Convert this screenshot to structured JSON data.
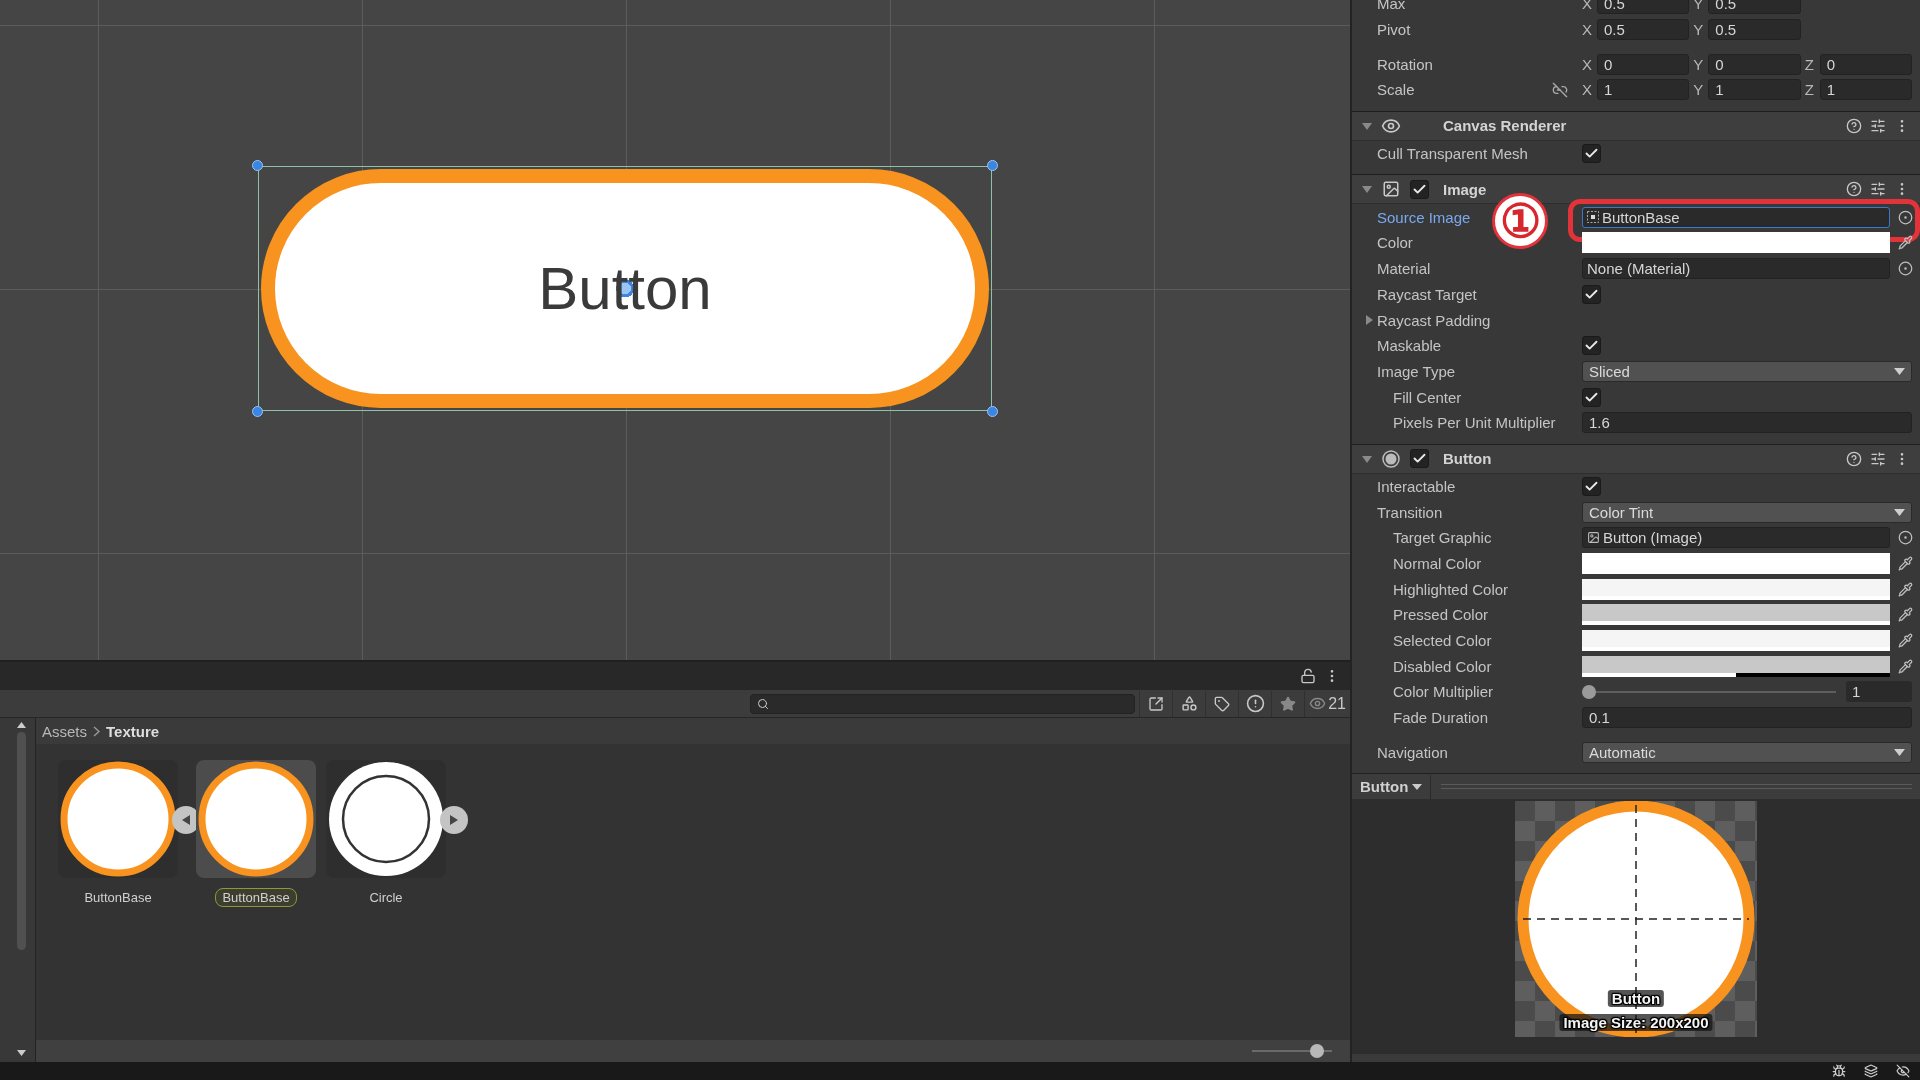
{
  "scene": {
    "button_text": "Button"
  },
  "project": {
    "item_count": "21",
    "breadcrumb": [
      {
        "label": "Assets"
      },
      {
        "label": "Texture"
      }
    ],
    "assets": [
      {
        "name": "ButtonBase",
        "kind": "bordered",
        "selected": false,
        "renaming": false,
        "expanded": true
      },
      {
        "name": "ButtonBase",
        "kind": "bordered",
        "selected": true,
        "renaming": true
      },
      {
        "name": "Circle",
        "kind": "ring",
        "selected": false,
        "renaming": false,
        "expanded": false
      }
    ],
    "zoom_slider": {
      "level": 0.88
    }
  },
  "inspector": {
    "transform": [
      {
        "label": "Max",
        "axes": [
          {
            "axis": "X",
            "value": "0.5"
          },
          {
            "axis": "Y",
            "value": "0.5"
          }
        ]
      },
      {
        "label": "Pivot",
        "axes": [
          {
            "axis": "X",
            "value": "0.5"
          },
          {
            "axis": "Y",
            "value": "0.5"
          }
        ]
      },
      {
        "label": "Rotation",
        "axes": [
          {
            "axis": "X",
            "value": "0"
          },
          {
            "axis": "Y",
            "value": "0"
          },
          {
            "axis": "Z",
            "value": "0"
          }
        ]
      },
      {
        "label": "Scale",
        "proportional": false,
        "axes": [
          {
            "axis": "X",
            "value": "1"
          },
          {
            "axis": "Y",
            "value": "1"
          },
          {
            "axis": "Z",
            "value": "1"
          }
        ]
      }
    ],
    "components": [
      {
        "title": "Canvas Renderer",
        "kind": "renderer",
        "expanded": true,
        "fields": [
          {
            "label": "Cull Transparent Mesh",
            "kind": "checkbox",
            "checked": true
          }
        ]
      },
      {
        "title": "Image",
        "kind": "image",
        "enabled": true,
        "expanded": true,
        "fields": [
          {
            "label": "Source Image",
            "kind": "spriteref",
            "value": "ButtonBase",
            "focused": true,
            "highlighted": true
          },
          {
            "label": "Color",
            "kind": "color",
            "color": "#ffffff",
            "level": 1
          },
          {
            "label": "Material",
            "kind": "object",
            "value": "None (Material)"
          },
          {
            "label": "Raycast Target",
            "kind": "checkbox",
            "checked": true
          },
          {
            "label": "Raycast Padding",
            "kind": "foldout",
            "expanded": false
          },
          {
            "label": "Maskable",
            "kind": "checkbox",
            "checked": true
          },
          {
            "label": "Image Type",
            "kind": "dropdown",
            "value": "Sliced",
            "children": [
              {
                "label": "Fill Center",
                "kind": "checkbox",
                "checked": true
              },
              {
                "label": "Pixels Per Unit Multiplier",
                "kind": "text",
                "value": "1.6"
              }
            ]
          }
        ]
      },
      {
        "title": "Button",
        "kind": "button",
        "enabled": true,
        "expanded": true,
        "fields": [
          {
            "label": "Interactable",
            "kind": "checkbox",
            "checked": true
          },
          {
            "label": "Transition",
            "kind": "dropdown",
            "value": "Color Tint",
            "children": [
              {
                "label": "Target Graphic",
                "kind": "imageref",
                "value": "Button (Image)"
              },
              {
                "label": "Normal Color",
                "kind": "color",
                "color": "#ffffff",
                "level": 1
              },
              {
                "label": "Highlighted Color",
                "kind": "color",
                "color": "#f5f5f5",
                "level": 1
              },
              {
                "label": "Pressed Color",
                "kind": "color",
                "color": "#c8c8c8",
                "level": 1
              },
              {
                "label": "Selected Color",
                "kind": "color",
                "color": "#f5f5f5",
                "level": 1
              },
              {
                "label": "Disabled Color",
                "kind": "color",
                "color": "#c8c8c8",
                "level": 0.5
              },
              {
                "label": "Color Multiplier",
                "kind": "slider",
                "level": 0,
                "value": "1"
              },
              {
                "label": "Fade Duration",
                "kind": "text",
                "value": "0.1"
              }
            ]
          },
          {
            "label": "Navigation",
            "kind": "dropdown",
            "value": "Automatic",
            "spaced": true
          }
        ]
      }
    ],
    "preview": {
      "target": "Button",
      "caption_title": "Button",
      "caption_size": "Image Size: 200x200"
    }
  },
  "annotation": {
    "marker": "①"
  }
}
